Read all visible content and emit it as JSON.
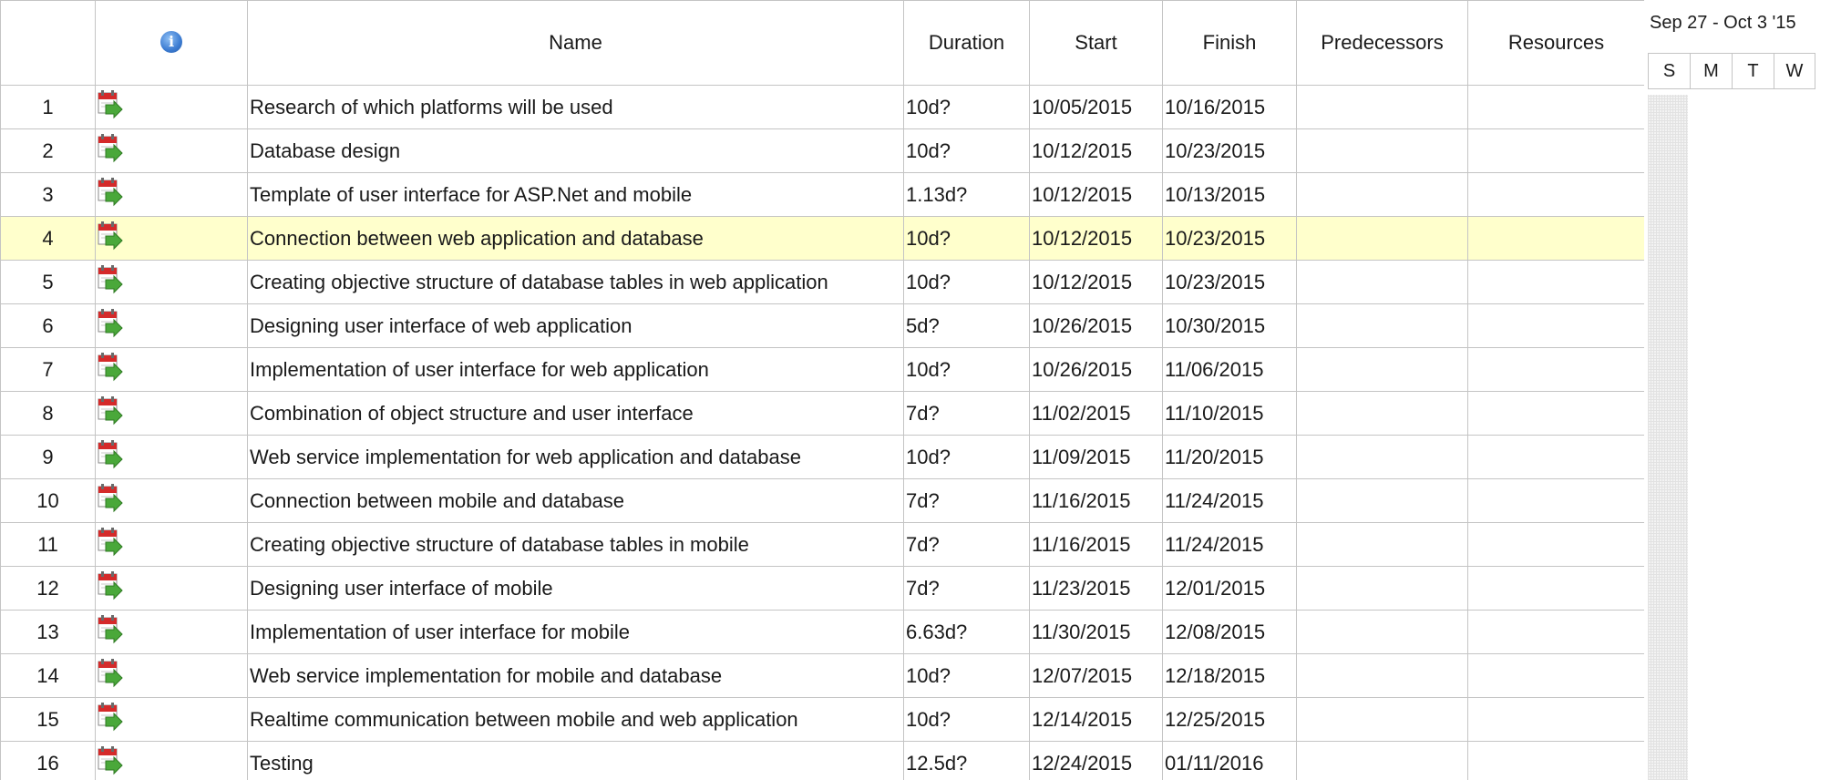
{
  "grid": {
    "columns": {
      "id": "",
      "info_icon": "information-icon",
      "name": "Name",
      "duration": "Duration",
      "start": "Start",
      "finish": "Finish",
      "predecessors": "Predecessors",
      "resources": "Resources"
    },
    "selected_row": 4,
    "rows": [
      {
        "id": "1",
        "icon": "task-icon",
        "name": "Research of which platforms will be used",
        "duration": "10d?",
        "start": "10/05/2015",
        "finish": "10/16/2015",
        "predecessors": "",
        "resources": ""
      },
      {
        "id": "2",
        "icon": "task-icon",
        "name": "Database design",
        "duration": "10d?",
        "start": "10/12/2015",
        "finish": "10/23/2015",
        "predecessors": "",
        "resources": ""
      },
      {
        "id": "3",
        "icon": "task-icon",
        "name": "Template of user interface for ASP.Net and mobile",
        "duration": "1.13d?",
        "start": "10/12/2015",
        "finish": "10/13/2015",
        "predecessors": "",
        "resources": ""
      },
      {
        "id": "4",
        "icon": "task-icon",
        "name": "Connection between web application and database",
        "duration": "10d?",
        "start": "10/12/2015",
        "finish": "10/23/2015",
        "predecessors": "",
        "resources": ""
      },
      {
        "id": "5",
        "icon": "task-icon",
        "name": "Creating objective structure of database tables in web application",
        "duration": "10d?",
        "start": "10/12/2015",
        "finish": "10/23/2015",
        "predecessors": "",
        "resources": ""
      },
      {
        "id": "6",
        "icon": "task-icon",
        "name": "Designing user interface of web application",
        "duration": "5d?",
        "start": "10/26/2015",
        "finish": "10/30/2015",
        "predecessors": "",
        "resources": ""
      },
      {
        "id": "7",
        "icon": "task-icon",
        "name": "Implementation of user interface for web application",
        "duration": "10d?",
        "start": "10/26/2015",
        "finish": "11/06/2015",
        "predecessors": "",
        "resources": ""
      },
      {
        "id": "8",
        "icon": "task-icon",
        "name": "Combination of object structure and user interface",
        "duration": "7d?",
        "start": "11/02/2015",
        "finish": "11/10/2015",
        "predecessors": "",
        "resources": ""
      },
      {
        "id": "9",
        "icon": "task-icon",
        "name": "Web service implementation for web application and database",
        "duration": "10d?",
        "start": "11/09/2015",
        "finish": "11/20/2015",
        "predecessors": "",
        "resources": ""
      },
      {
        "id": "10",
        "icon": "task-icon",
        "name": "Connection between mobile and database",
        "duration": "7d?",
        "start": "11/16/2015",
        "finish": "11/24/2015",
        "predecessors": "",
        "resources": ""
      },
      {
        "id": "11",
        "icon": "task-icon",
        "name": "Creating objective structure of database tables in mobile",
        "duration": "7d?",
        "start": "11/16/2015",
        "finish": "11/24/2015",
        "predecessors": "",
        "resources": ""
      },
      {
        "id": "12",
        "icon": "task-icon",
        "name": "Designing user interface of mobile",
        "duration": "7d?",
        "start": "11/23/2015",
        "finish": "12/01/2015",
        "predecessors": "",
        "resources": ""
      },
      {
        "id": "13",
        "icon": "task-icon",
        "name": "Implementation of user interface for mobile",
        "duration": "6.63d?",
        "start": "11/30/2015",
        "finish": "12/08/2015",
        "predecessors": "",
        "resources": ""
      },
      {
        "id": "14",
        "icon": "task-icon",
        "name": "Web service implementation for mobile and database",
        "duration": "10d?",
        "start": "12/07/2015",
        "finish": "12/18/2015",
        "predecessors": "",
        "resources": ""
      },
      {
        "id": "15",
        "icon": "task-icon",
        "name": "Realtime communication between mobile and web application",
        "duration": "10d?",
        "start": "12/14/2015",
        "finish": "12/25/2015",
        "predecessors": "",
        "resources": ""
      },
      {
        "id": "16",
        "icon": "task-icon",
        "name": "Testing",
        "duration": "12.5d?",
        "start": "12/24/2015",
        "finish": "01/11/2016",
        "predecessors": "",
        "resources": ""
      }
    ]
  },
  "timescale": {
    "week_label": "Sep 27 - Oct 3 '15",
    "days": [
      "S",
      "M",
      "T",
      "W"
    ]
  },
  "colors": {
    "selected_row": "#ffffcc",
    "grid_line": "#c4c4c4",
    "info_icon": "#3b7bd1",
    "task_icon_red": "#d42a2a",
    "task_icon_green": "#4aa83a"
  }
}
